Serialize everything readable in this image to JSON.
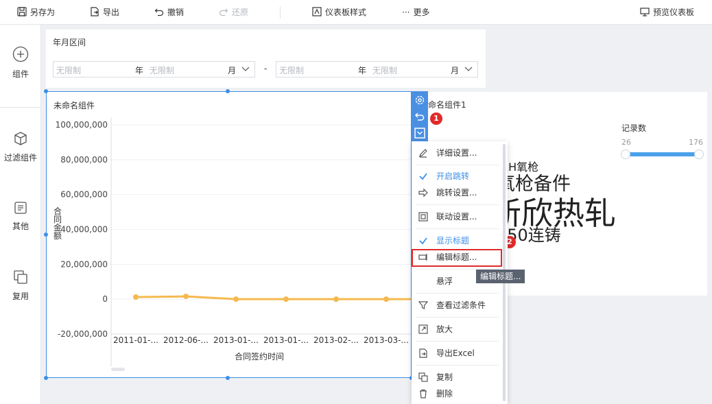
{
  "toolbar": {
    "save_as": "另存为",
    "export": "导出",
    "undo": "撤销",
    "redo": "还原",
    "dashboard_style": "仪表板样式",
    "more": "更多",
    "preview": "预览仪表板"
  },
  "sidebar": {
    "items": [
      {
        "label": "组件",
        "icon": "plus-circle-icon"
      },
      {
        "label": "过滤组件",
        "icon": "cube-icon"
      },
      {
        "label": "其他",
        "icon": "document-icon"
      },
      {
        "label": "复用",
        "icon": "copy-icon"
      }
    ]
  },
  "filter": {
    "title": "年月区间",
    "start_year_placeholder": "无限制",
    "start_year_unit": "年",
    "start_month_placeholder": "无限制",
    "start_month_unit": "月",
    "dash": "-",
    "end_year_placeholder": "无限制",
    "end_year_unit": "年",
    "end_month_placeholder": "无限制",
    "end_month_unit": "月"
  },
  "widget1": {
    "title": "未命名组件"
  },
  "chart_data": {
    "type": "line",
    "title": "",
    "xlabel": "合同签约时间",
    "ylabel": "合同金额",
    "categories": [
      "2011-01-...",
      "2012-06-...",
      "2013-01-...",
      "2013-01-...",
      "2013-02-...",
      "2013-03-...",
      ""
    ],
    "yticks": [
      "100,000,000",
      "80,000,000",
      "60,000,000",
      "40,000,000",
      "20,000,000",
      "0",
      "-20,000,000"
    ],
    "ylim": [
      -20000000,
      100000000
    ],
    "series": [
      {
        "values": [
          1200000,
          1600000,
          0,
          0,
          0,
          0,
          0
        ]
      }
    ],
    "grid": "horizontal",
    "line_color": "#f5b94e"
  },
  "markers": {
    "one": "1",
    "two": "2"
  },
  "widget2": {
    "title": "未命名组件1",
    "words": [
      "RH氧枪",
      "氧枪备件",
      "新欣热轧",
      "650连铸"
    ],
    "slider": {
      "label": "记录数",
      "min": "26",
      "max": "176"
    }
  },
  "menu": {
    "items": [
      {
        "label": "详细设置...",
        "icon": "pencil-icon",
        "checked": false
      },
      {
        "label": "开启跳转",
        "icon": "check-icon",
        "checked": true
      },
      {
        "label": "跳转设置...",
        "icon": "jump-arrow-icon",
        "checked": false
      },
      {
        "label": "联动设置...",
        "icon": "link-icon",
        "checked": false
      },
      {
        "label": "显示标题",
        "icon": "check-icon",
        "checked": true
      },
      {
        "label": "编辑标题...",
        "icon": "edit-title-icon",
        "checked": false
      },
      {
        "label": "悬浮",
        "icon": "",
        "checked": false
      },
      {
        "label": "查看过滤条件",
        "icon": "filter-icon",
        "checked": false
      },
      {
        "label": "放大",
        "icon": "expand-icon",
        "checked": false
      },
      {
        "label": "导出Excel",
        "icon": "export-icon",
        "checked": false
      },
      {
        "label": "复制",
        "icon": "copy-icon",
        "checked": false
      },
      {
        "label": "删除",
        "icon": "trash-icon",
        "checked": false
      }
    ]
  },
  "tooltip": "编辑标题..."
}
